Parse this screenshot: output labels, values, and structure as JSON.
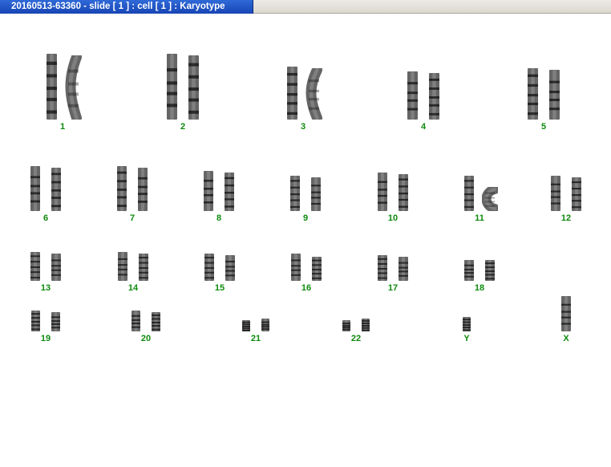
{
  "window": {
    "title": "20160513-63360 - slide [ 1 ] : cell [ 1 ] : Karyotype"
  },
  "colors": {
    "title_bar": "#1f52c4",
    "label": "#0d8a0d",
    "chromosome": "#2a2a2a"
  },
  "karyotype": {
    "chromosomes": [
      {
        "label": "1"
      },
      {
        "label": "2"
      },
      {
        "label": "3"
      },
      {
        "label": "4"
      },
      {
        "label": "5"
      },
      {
        "label": "6"
      },
      {
        "label": "7"
      },
      {
        "label": "8"
      },
      {
        "label": "9"
      },
      {
        "label": "10"
      },
      {
        "label": "11"
      },
      {
        "label": "12"
      },
      {
        "label": "13"
      },
      {
        "label": "14"
      },
      {
        "label": "15"
      },
      {
        "label": "16"
      },
      {
        "label": "17"
      },
      {
        "label": "18"
      },
      {
        "label": "19"
      },
      {
        "label": "20"
      },
      {
        "label": "21"
      },
      {
        "label": "22"
      },
      {
        "label": "Y"
      },
      {
        "label": "X"
      }
    ]
  }
}
